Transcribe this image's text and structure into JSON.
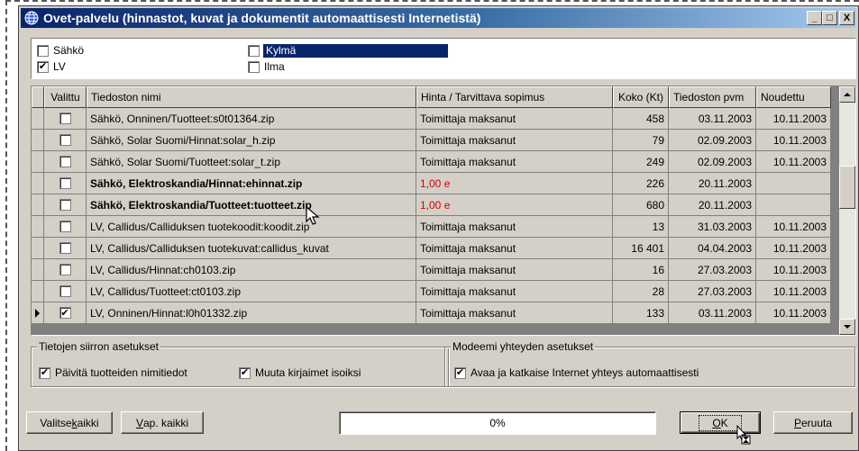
{
  "window": {
    "title": "Ovet-palvelu (hinnastot, kuvat ja dokumentit automaattisesti Internetistä)",
    "buttons": {
      "minimize": "_",
      "maximize": "□",
      "close": "X"
    }
  },
  "categories": [
    {
      "label": "Sähkö",
      "checked": false
    },
    {
      "label": "Kylmä",
      "checked": false,
      "selected": true
    },
    {
      "label": "LV",
      "checked": true
    },
    {
      "label": "Ilma",
      "checked": false
    }
  ],
  "table": {
    "columns": [
      "Valittu",
      "Tiedoston nimi",
      "Hinta / Tarvittava sopimus",
      "Koko (Kt)",
      "Tiedoston pvm",
      "Noudettu"
    ],
    "rows": [
      {
        "checked": false,
        "name": "Sähkö, Onninen/Tuotteet:s0t01364.zip",
        "price": "Toimittaja maksanut",
        "size": "458",
        "date": "03.11.2003",
        "fetched": "10.11.2003",
        "bold": false
      },
      {
        "checked": false,
        "name": "Sähkö, Solar Suomi/Hinnat:solar_h.zip",
        "price": "Toimittaja maksanut",
        "size": "79",
        "date": "02.09.2003",
        "fetched": "10.11.2003",
        "bold": false
      },
      {
        "checked": false,
        "name": "Sähkö, Solar Suomi/Tuotteet:solar_t.zip",
        "price": "Toimittaja maksanut",
        "size": "249",
        "date": "02.09.2003",
        "fetched": "10.11.2003",
        "bold": false
      },
      {
        "checked": false,
        "name": "Sähkö, Elektroskandia/Hinnat:ehinnat.zip",
        "price": "1,00 e",
        "size": "226",
        "date": "20.11.2003",
        "fetched": "",
        "bold": true
      },
      {
        "checked": false,
        "name": "Sähkö, Elektroskandia/Tuotteet:tuotteet.zip",
        "price": "1,00 e",
        "size": "680",
        "date": "20.11.2003",
        "fetched": "",
        "bold": true
      },
      {
        "checked": false,
        "name": "LV, Callidus/Calliduksen tuotekoodit:koodit.zip",
        "price": "Toimittaja maksanut",
        "size": "13",
        "date": "31.03.2003",
        "fetched": "10.11.2003",
        "bold": false
      },
      {
        "checked": false,
        "name": "LV, Callidus/Calliduksen tuotekuvat:callidus_kuvat",
        "price": "Toimittaja maksanut",
        "size": "16 401",
        "date": "04.04.2003",
        "fetched": "10.11.2003",
        "bold": false
      },
      {
        "checked": false,
        "name": "LV, Callidus/Hinnat:ch0103.zip",
        "price": "Toimittaja maksanut",
        "size": "16",
        "date": "27.03.2003",
        "fetched": "10.11.2003",
        "bold": false
      },
      {
        "checked": false,
        "name": "LV, Callidus/Tuotteet:ct0103.zip",
        "price": "Toimittaja maksanut",
        "size": "28",
        "date": "27.03.2003",
        "fetched": "10.11.2003",
        "bold": false
      },
      {
        "checked": true,
        "name": "LV, Onninen/Hinnat:l0h01332.zip",
        "price": "Toimittaja maksanut",
        "size": "133",
        "date": "03.11.2003",
        "fetched": "10.11.2003",
        "bold": false,
        "current": true
      }
    ]
  },
  "transfer_settings": {
    "legend": "Tietojen siirron asetukset",
    "update_names": {
      "label": "Päivitä tuotteiden nimitiedot",
      "checked": true
    },
    "uppercase": {
      "label": "Muuta kirjaimet isoiksi",
      "checked": true
    }
  },
  "modem_settings": {
    "legend": "Modeemi yhteyden asetukset",
    "auto_connect": {
      "label": "Avaa ja katkaise Internet yhteys automaattisesti",
      "checked": true
    }
  },
  "footer": {
    "select_all_prefix": "Valitse ",
    "select_all_access": "k",
    "select_all_suffix": "aikki",
    "deselect_access": "V",
    "deselect_suffix": "ap. kaikki",
    "progress": "0%",
    "progress_value": 0,
    "ok_access": "O",
    "ok_suffix": "K",
    "cancel_access": "P",
    "cancel_suffix": "eruuta"
  },
  "colors": {
    "title_start": "#0a246a",
    "title_end": "#a6caf0",
    "price_red": "#d10000",
    "face": "#d4d0c8"
  }
}
